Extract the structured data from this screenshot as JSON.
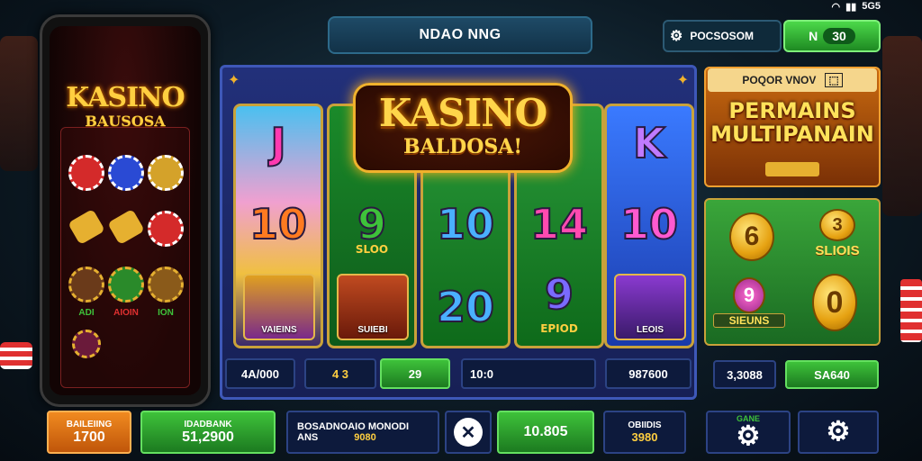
{
  "status_bar": {
    "wifi_icon": "wifi-icon",
    "battery_text": "5G5"
  },
  "title_bar": {
    "label": "NDAO NNG"
  },
  "top_right": {
    "account_label": "POCSOSOM",
    "balance_value": "30",
    "balance_prefix": "N"
  },
  "phone": {
    "title": "KASINO",
    "subtitle": "BAUSOSA",
    "labels": [
      "ADI",
      "AIOIN",
      "ION"
    ]
  },
  "game_logo": {
    "title": "KASINO",
    "subtitle": "BALDOSA!"
  },
  "reels": [
    {
      "top": "J",
      "mid": "10",
      "card_label": "VAIEINS"
    },
    {
      "top": "",
      "mid": "9",
      "mid_tag": "SLOO",
      "card_label": "SUIEBI"
    },
    {
      "top": "",
      "mid": "10",
      "bottom": "20"
    },
    {
      "top": "",
      "mid": "14",
      "bottom": "9",
      "bottom_tag": "EPIOD"
    },
    {
      "top": "K",
      "mid": "10",
      "card_label": "LEOIS"
    }
  ],
  "controls": {
    "bet": "4A/000",
    "lines": "4 3",
    "spin_value": "29",
    "win": "10:0",
    "credit": "987600"
  },
  "right_panel": {
    "header": "POQOR VNOV",
    "multiplier_line1": "PERMAINS",
    "multiplier_line2": "MULTIPANAIN",
    "grid_symbols": [
      "6",
      "3",
      "SLIOIS",
      "9",
      "SIEUNS",
      "0"
    ],
    "stat_value": "3,3088",
    "action_value": "SA640"
  },
  "bottom_bar": {
    "balance_label": "BAILEIING",
    "balance_value": "1700",
    "bank_label": "IDADBANK",
    "bank_value": "51,2900",
    "info_line1": "BOSADNOAIO MONODI",
    "info_line2_a": "ANS",
    "info_line2_b": "9080",
    "total_value": "10.805",
    "counter_label": "OBIIDIS",
    "counter_value": "3980",
    "game_label": "GANE"
  },
  "colors": {
    "accent_gold": "#f0b22c",
    "green": "#3ec23a",
    "orange": "#e07a10",
    "frame_blue": "#3e58b8"
  }
}
